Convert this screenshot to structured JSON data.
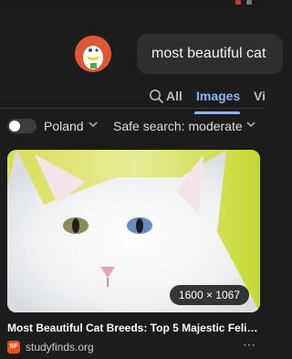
{
  "search": {
    "query": "most beautiful cat"
  },
  "tabs": [
    {
      "label": "All"
    },
    {
      "label": "Images"
    },
    {
      "label": "Vi"
    }
  ],
  "filters": {
    "region": "Poland",
    "safe_search": "Safe search: moderate"
  },
  "result": {
    "dimensions": "1600 × 1067",
    "title": "Most Beautiful Cat Breeds: Top 5 Majestic Feli…",
    "source": "studyfinds.org",
    "favicon_text": "SF",
    "more": "⋯"
  },
  "colors": {
    "background": "#1c1c1c",
    "accent": "#8ab4f8",
    "logo": "#de5833"
  }
}
